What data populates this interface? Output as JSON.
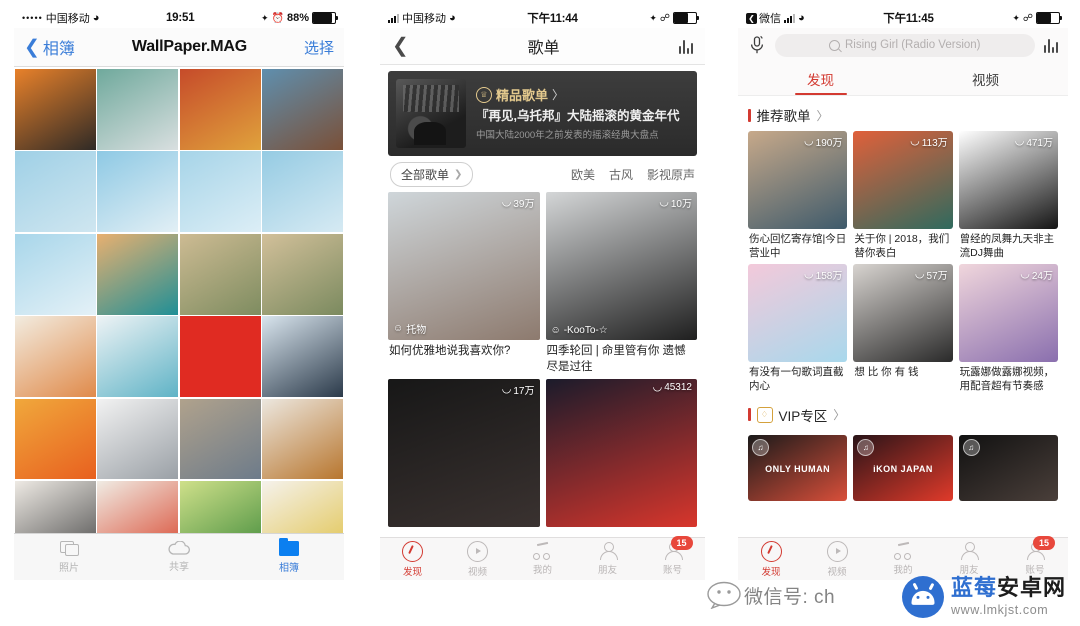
{
  "panel1": {
    "status": {
      "dots": "•••••",
      "carrier": "中国移动",
      "time": "19:51",
      "battery": "88%"
    },
    "nav": {
      "back": "相簿",
      "title": "WallPaper.MAG",
      "select": "选择"
    },
    "photos": [
      {
        "name": "raccoon-headdress",
        "c1": "#e8812a",
        "c2": "#2f2a26"
      },
      {
        "name": "polar-bear-bowtie",
        "c1": "#6fa99c",
        "c2": "#d9dfe0"
      },
      {
        "name": "lion-mountains",
        "c1": "#c64b2a",
        "c2": "#e0a23c"
      },
      {
        "name": "walrus-ice",
        "c1": "#5f8fae",
        "c2": "#7a5038"
      },
      {
        "name": "aerial-blue-01",
        "c1": "#9fd0e6",
        "c2": "#cfe6f0"
      },
      {
        "name": "aerial-blue-02",
        "c1": "#8ec9e4",
        "c2": "#e2eff5"
      },
      {
        "name": "aerial-blue-03",
        "c1": "#a6d4e8",
        "c2": "#dceef6"
      },
      {
        "name": "aerial-blue-04",
        "c1": "#95cbe3",
        "c2": "#d6eaf3"
      },
      {
        "name": "aerial-blue-05",
        "c1": "#a8d6ea",
        "c2": "#e4f1f7"
      },
      {
        "name": "beach-sunset",
        "c1": "#e8b070",
        "c2": "#1f8f96"
      },
      {
        "name": "terrain-aerial-01",
        "c1": "#cdbb93",
        "c2": "#7e8c60"
      },
      {
        "name": "terrain-aerial-02",
        "c1": "#d2c09a",
        "c2": "#7b8a5f"
      },
      {
        "name": "minimal-sand",
        "c1": "#f2ece0",
        "c2": "#e08a4a"
      },
      {
        "name": "snow-skiers",
        "c1": "#eef3f5",
        "c2": "#5fb3c6"
      },
      {
        "name": "red-minimal",
        "c1": "#e02b22",
        "c2": "#e02b22"
      },
      {
        "name": "drummer-silhouette",
        "c1": "#d9e5ee",
        "c2": "#2b3a4a"
      },
      {
        "name": "sunset-figure",
        "c1": "#f0a83c",
        "c2": "#e8601f"
      },
      {
        "name": "stormtrooper",
        "c1": "#f2f2f2",
        "c2": "#9aa0a6"
      },
      {
        "name": "desert-walker",
        "c1": "#b0a28c",
        "c2": "#6d7b8a"
      },
      {
        "name": "bb8-droid",
        "c1": "#ece7df",
        "c2": "#b8762e"
      },
      {
        "name": "antlers",
        "c1": "#eeeae4",
        "c2": "#4a4a4a"
      },
      {
        "name": "figurine-red",
        "c1": "#f0ece4",
        "c2": "#d8442c"
      },
      {
        "name": "limes-green",
        "c1": "#cfe08a",
        "c2": "#3f8a3a"
      },
      {
        "name": "citrus-flatlay",
        "c1": "#f5f2ec",
        "c2": "#e0c24a"
      }
    ],
    "tabs": [
      {
        "label": "照片",
        "icon": "photos-stack-icon",
        "active": false
      },
      {
        "label": "共享",
        "icon": "cloud-icon",
        "active": false
      },
      {
        "label": "相簿",
        "icon": "album-folder-icon",
        "active": true
      }
    ]
  },
  "panel2": {
    "status": {
      "carrier": "中国移动",
      "time": "下午11:44"
    },
    "nav": {
      "title": "歌单",
      "eq_icon": "equalizer-icon",
      "back_icon": "chevron-left-icon"
    },
    "banner": {
      "tag": "精品歌单",
      "arrow": "〉",
      "title": "『再见,乌托邦』大陆摇滚的黄金年代",
      "subtitle": "中国大陆2000年之前发表的摇滚经典大盘点"
    },
    "filter": {
      "pill": "全部歌单",
      "tags": [
        "欧美",
        "古风",
        "影视原声"
      ]
    },
    "cards": [
      {
        "title": "如何优雅地说我喜欢你?",
        "plays": "39万",
        "author": "托物",
        "c1": "#cfd6da",
        "c2": "#8d7a6e",
        "name": "playlist-card-1"
      },
      {
        "title": "四季轮回 | 命里管有你 遗憾尽是过往",
        "plays": "10万",
        "author": "-KooTo-☆",
        "c1": "#d4d6d7",
        "c2": "#1f1f1f",
        "name": "playlist-card-2"
      },
      {
        "title": "",
        "plays": "17万",
        "author": "",
        "c1": "#171717",
        "c2": "#3a3230",
        "name": "playlist-card-3"
      },
      {
        "title": "",
        "plays": "45312",
        "author": "",
        "c1": "#1b1b2b",
        "c2": "#d8362c",
        "name": "playlist-card-4"
      }
    ],
    "tabs": [
      {
        "label": "发现",
        "icon": "netease-disc-icon",
        "active": true,
        "badge": ""
      },
      {
        "label": "视频",
        "icon": "video-play-icon",
        "active": false,
        "badge": ""
      },
      {
        "label": "我的",
        "icon": "music-note-icon",
        "active": false,
        "badge": ""
      },
      {
        "label": "朋友",
        "icon": "person-icon",
        "active": false,
        "badge": ""
      },
      {
        "label": "账号",
        "icon": "account-icon",
        "active": false,
        "badge": "15"
      }
    ]
  },
  "panel3": {
    "status": {
      "back_app": "微信",
      "time": "下午11:45"
    },
    "search": {
      "placeholder": "Rising Girl (Radio Version)",
      "mic_icon": "microphone-icon",
      "eq_icon": "equalizer-icon"
    },
    "tabs": [
      {
        "label": "发现",
        "icon": "netease-disc-icon",
        "active": true,
        "badge": ""
      },
      {
        "label": "视频",
        "icon": "video-play-icon",
        "active": false,
        "badge": ""
      },
      {
        "label": "我的",
        "icon": "music-note-icon",
        "active": false,
        "badge": ""
      },
      {
        "label": "朋友",
        "icon": "person-icon",
        "active": false,
        "badge": ""
      },
      {
        "label": "账号",
        "icon": "account-icon",
        "active": false,
        "badge": "15"
      }
    ],
    "section_recommend": {
      "title": "推荐歌单",
      "arrow": "〉"
    },
    "recommend_cards": [
      {
        "title": "伤心回忆寄存馆|今日营业中",
        "plays": "190万",
        "c1": "#c7a98a",
        "c2": "#3e5a6b",
        "name": "recommend-card-1"
      },
      {
        "title": "关于你 | 2018，我们替你表白",
        "plays": "113万",
        "c1": "#e0603a",
        "c2": "#2f6a5e",
        "name": "recommend-card-2"
      },
      {
        "title": "曾经的凤舞九天非主流DJ舞曲",
        "plays": "471万",
        "c1": "#ffffff",
        "c2": "#141414",
        "name": "recommend-card-3"
      },
      {
        "title": "有没有一句歌词直截内心",
        "plays": "158万",
        "c1": "#f3c9da",
        "c2": "#a8d8ec",
        "name": "recommend-card-4"
      },
      {
        "title": "想 比 你 有 钱",
        "plays": "57万",
        "c1": "#d8d4d0",
        "c2": "#2a2a2a",
        "name": "recommend-card-5"
      },
      {
        "title": "玩露娜做露娜视频，用配音超有节奏感",
        "plays": "24万",
        "c1": "#f0d6dc",
        "c2": "#8a6fae",
        "name": "recommend-card-6"
      }
    ],
    "section_vip": {
      "title": "VIP专区",
      "arrow": "〉",
      "icon": "vip-diamond-icon"
    },
    "vip_cards": [
      {
        "name": "vip-card-only-human",
        "label": "ONLY HUMAN",
        "c1": "#1a1a1a",
        "c2": "#d94f3a"
      },
      {
        "name": "vip-card-ikon-japan",
        "label": "iKON JAPAN",
        "c1": "#2a1418",
        "c2": "#e03a2a"
      },
      {
        "name": "vip-card-group-photo",
        "label": "",
        "c1": "#111111",
        "c2": "#4a3f3a"
      }
    ]
  },
  "watermark": {
    "wechat_text": "微信号: ch",
    "brand_top_1": "蓝莓",
    "brand_top_2": "安卓网",
    "brand_url": "www.lmkjst.com",
    "droid_icon": "android-robot-icon",
    "chat_icon": "chat-bubble-icon"
  }
}
